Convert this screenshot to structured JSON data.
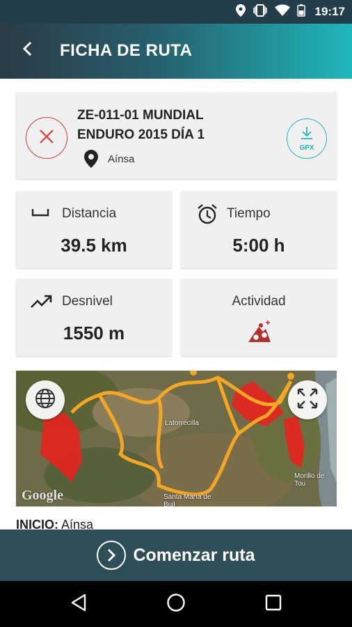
{
  "status_bar": {
    "time": "19:17"
  },
  "app_bar": {
    "title": "FICHA DE RUTA"
  },
  "route": {
    "name": "ZE-011-01 MUNDIAL ENDURO 2015 DÍA 1",
    "location": "Aínsa",
    "gpx_label": "GPX"
  },
  "stats": {
    "distance": {
      "label": "Distancia",
      "value": "39.5 km"
    },
    "time": {
      "label": "Tiempo",
      "value": "5:00 h"
    },
    "elevation": {
      "label": "Desnivel",
      "value": "1550 m"
    },
    "activity": {
      "label": "Actividad",
      "icon": "mountain-bike-icon"
    }
  },
  "map": {
    "labels": [
      "Latorrecilla",
      "Morillo de Tou",
      "Santa María de Buil"
    ],
    "attribution": "Google",
    "route_color": "#f5a623",
    "zone_color": "#e8231e"
  },
  "start_info": {
    "label": "INICIO:",
    "value": "Aínsa"
  },
  "start_button": {
    "label": "Comenzar ruta"
  },
  "colors": {
    "accent": "#1fb7bb",
    "danger": "#e03a3a",
    "bar": "#2f4f58"
  }
}
